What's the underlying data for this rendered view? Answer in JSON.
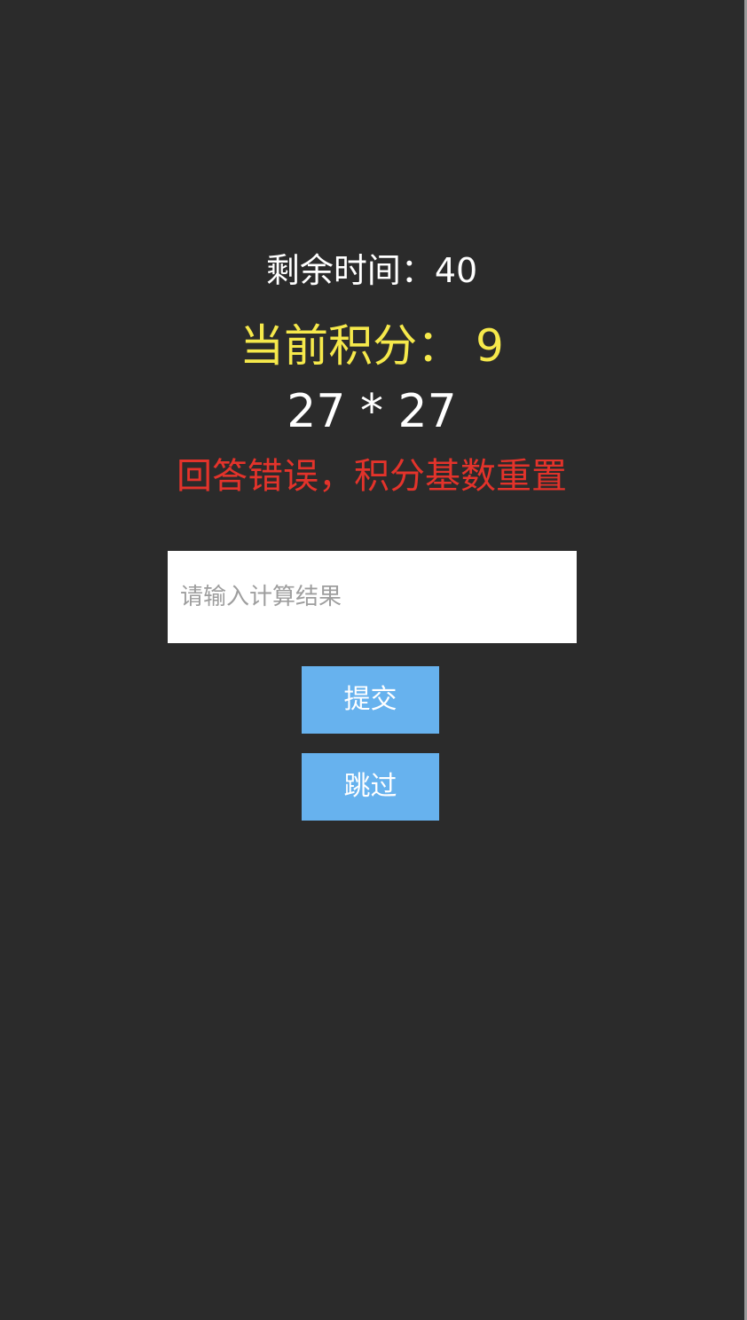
{
  "game": {
    "timer_text": "剩余时间：40",
    "score_text": "当前积分：  9",
    "question": "27 * 27",
    "feedback": "回答错误，积分基数重置"
  },
  "form": {
    "answer_placeholder": "请输入计算结果",
    "answer_value": "",
    "submit_label": "提交",
    "skip_label": "跳过"
  },
  "colors": {
    "background": "#2b2b2b",
    "score": "#f6e94b",
    "feedback": "#e3332b",
    "button": "#67b2ee"
  }
}
